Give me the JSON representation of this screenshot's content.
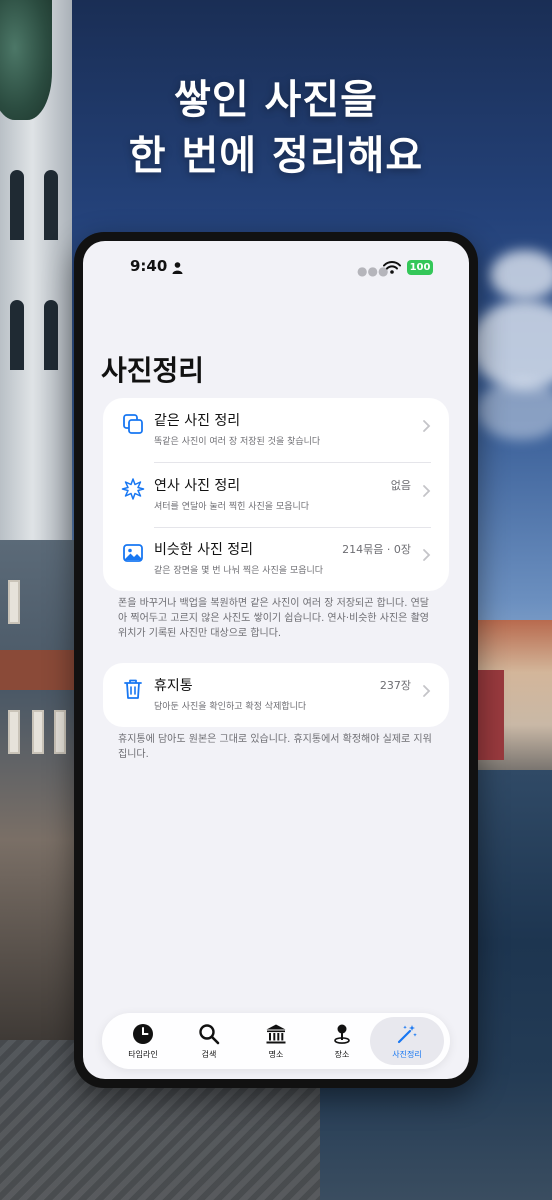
{
  "headline": {
    "line1": "쌓인 사진을",
    "line2": "한 번에 정리해요"
  },
  "status_bar": {
    "time": "9:40",
    "battery": "100",
    "icons": [
      "person-icon",
      "signal-dots",
      "wifi-icon",
      "battery-icon"
    ]
  },
  "page": {
    "title": "사진정리"
  },
  "cleanup_card": {
    "rows": [
      {
        "title": "같은 사진 정리",
        "subtitle": "똑같은 사진이 여러 장 저장된 것을 찾습니다",
        "meta": "",
        "icon": "duplicate-photos-icon"
      },
      {
        "title": "연사 사진 정리",
        "subtitle": "셔터를 연달아 눌러 찍힌 사진을 모읍니다",
        "meta": "없음",
        "icon": "burst-photos-icon"
      },
      {
        "title": "비슷한 사진 정리",
        "subtitle": "같은 장면을 몇 번 나눠 찍은 사진을 모읍니다",
        "meta": "214묶음 · 0장",
        "icon": "similar-photos-icon"
      }
    ],
    "footnote": "폰을 바꾸거나 백업을 복원하면 같은 사진이 여러 장 저장되곤 합니다. 연달아 찍어두고 고르지 않은 사진도 쌓이기 쉽습니다. 연사·비슷한 사진은 촬영 위치가 기록된 사진만 대상으로 합니다."
  },
  "trash_card": {
    "title": "휴지통",
    "subtitle": "담아둔 사진을 확인하고 확정 삭제합니다",
    "meta": "237장",
    "icon": "trash-icon",
    "footnote": "휴지통에 담아도 원본은 그대로 있습니다. 휴지통에서 확정해야 실제로 지워집니다."
  },
  "tab_bar": {
    "tabs": [
      {
        "label": "타임라인",
        "icon": "clock-icon"
      },
      {
        "label": "검색",
        "icon": "search-icon"
      },
      {
        "label": "명소",
        "icon": "landmark-icon"
      },
      {
        "label": "장소",
        "icon": "location-pin-icon"
      },
      {
        "label": "사진정리",
        "icon": "magic-wand-icon"
      }
    ],
    "active_index": 4
  },
  "colors": {
    "accent": "#1877f2",
    "battery": "#34c759",
    "screen_bg": "#f2f2f7"
  }
}
